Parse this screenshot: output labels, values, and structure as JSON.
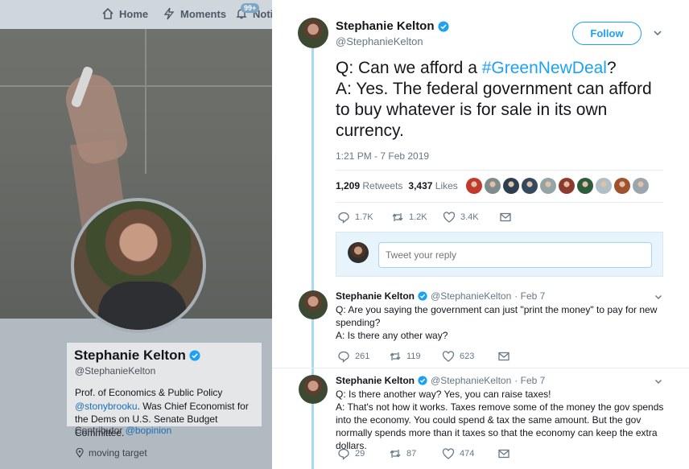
{
  "nav": {
    "home": "Home",
    "moments": "Moments",
    "notifications": "Notif",
    "notif_badge": "99+"
  },
  "profile": {
    "name": "Stephanie Kelton",
    "handle": "@StephanieKelton",
    "bio_line1": "Prof. of Economics & Public Policy",
    "bio_link": "@stonybrooku",
    "bio_line2": ". Was Chief Economist for the Dems on U.S. Senate Budget Committee.",
    "contributor_label": "Contributor ",
    "contributor_link": "@bopinion",
    "location": "moving target"
  },
  "tweet": {
    "author_name": "Stephanie Kelton",
    "author_handle": "@StephanieKelton",
    "follow_label": "Follow",
    "text_prefix": "Q: Can we afford a ",
    "hashtag": "#GreenNewDeal",
    "text_suffix": "?",
    "text_line2": "A: Yes. The federal government can afford to buy whatever is for sale in its own currency.",
    "timestamp": "1:21 PM - 7 Feb 2019",
    "retweets_count": "1,209",
    "retweets_label": "Retweets",
    "likes_count": "3,437",
    "likes_label": "Likes",
    "reply_count": "1.7K",
    "retweet_count_short": "1.2K",
    "like_count_short": "3.4K",
    "reply_placeholder": "Tweet your reply"
  },
  "likers_colors": [
    "#c0392b",
    "#7f8c8d",
    "#2c3e50",
    "#34495e",
    "#95a5a6",
    "#8e3b2f",
    "#2d5d3a",
    "#b0bec5",
    "#a0522d",
    "#9aa5ad"
  ],
  "replies": [
    {
      "name": "Stephanie Kelton",
      "handle": "@StephanieKelton",
      "date": "· Feb 7",
      "line1": "Q: Are you saying the government can just \"print the money\" to pay for new spending?",
      "line2": "A: Is there any other way?",
      "reply_count": "261",
      "retweet_count": "119",
      "like_count": "623"
    },
    {
      "name": "Stephanie Kelton",
      "handle": "@StephanieKelton",
      "date": "· Feb 7",
      "line1": "Q: Is there another way? Yes, you can raise taxes!",
      "line2": "A: That's not how it works. Taxes remove some of the money the gov spends into the economy. You could spend & tax the same amount. But the gov normally spends more than it taxes so that the economy can keep the extra dollars.",
      "reply_count": "29",
      "retweet_count": "87",
      "like_count": "474"
    }
  ],
  "colors": {
    "accent": "#1da1f2",
    "thread_line": "#a8d8f3"
  }
}
